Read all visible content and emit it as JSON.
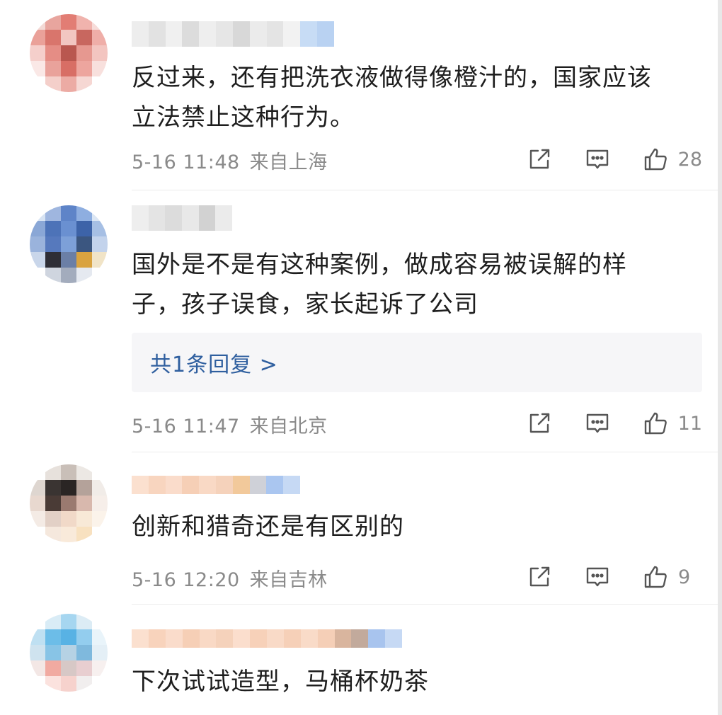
{
  "comments": [
    {
      "text_line1": "反过来，还有把洗衣液做得像橙汁的，国家应该",
      "text_line2": "立法禁止这种行为。",
      "time": "5-16 11:48",
      "location": "来自上海",
      "likes": "28"
    },
    {
      "text_line1": "国外是不是有这种案例，做成容易被误解的样",
      "text_line2": "子，孩子误食，家长起诉了公司",
      "reply_link": "共1条回复 >",
      "time": "5-16 11:47",
      "location": "来自北京",
      "likes": "11"
    },
    {
      "text_line1": "创新和猎奇还是有区别的",
      "time": "5-16 12:20",
      "location": "来自吉林",
      "likes": "9"
    },
    {
      "text_line1": "下次试试造型，马桶杯奶茶"
    }
  ],
  "icons": {
    "repost": "repost-icon",
    "comment": "comment-icon",
    "like": "thumbs-up-icon"
  },
  "colors": {
    "text": "#1e1e1e",
    "meta": "#8a8a8a",
    "link": "#2f5f9f",
    "reply_bg": "#f6f6f8",
    "divider": "#ececec"
  }
}
